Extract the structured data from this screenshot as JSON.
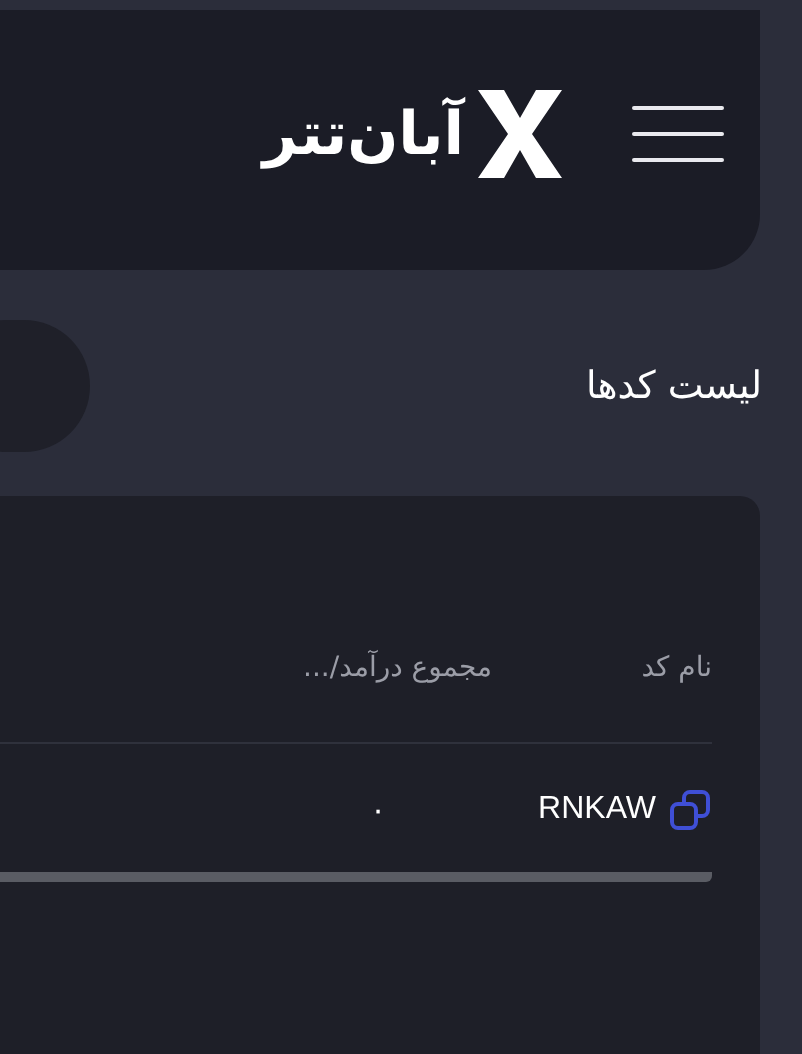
{
  "header": {
    "brand": "آبان‌تتر"
  },
  "page_title": "لیست کدها",
  "table": {
    "columns": [
      "نام کد",
      "مجموع درآمد/..."
    ],
    "rows": [
      {
        "code": "RNKAW",
        "total": "۰"
      }
    ]
  }
}
